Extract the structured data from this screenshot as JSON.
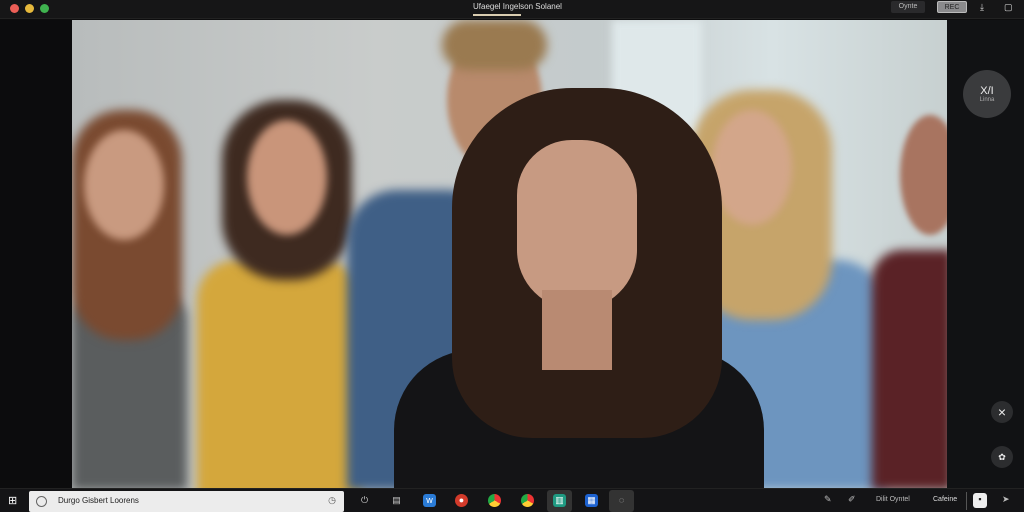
{
  "window": {
    "title": "Ufaegel Ingelson Solanel",
    "buttons": {
      "share": "Oynte",
      "record": "REC"
    },
    "icons": [
      "download-icon",
      "window-icon"
    ]
  },
  "side_controls": {
    "avatar_text": "X/I",
    "avatar_label": "Linna",
    "close": "×"
  },
  "taskbar": {
    "search_value": "Durgo Gisbert Loorens",
    "tray_text_1": "Dilit Oyntel",
    "tray_text_2": "Cafeine"
  },
  "colors": {
    "accent": "#d8ccb0",
    "dark": "#141416"
  }
}
